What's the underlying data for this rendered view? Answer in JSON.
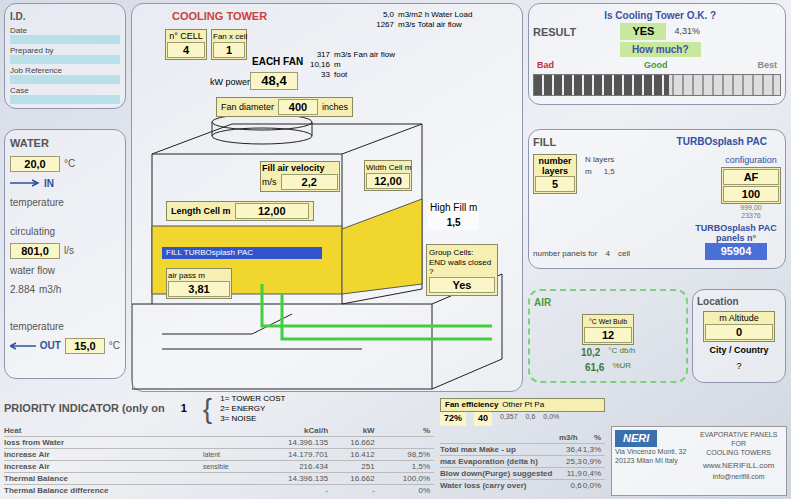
{
  "id_panel": {
    "title": "I.D.",
    "fields": [
      "Date",
      "Prepared by",
      "Job Reference",
      "Case"
    ]
  },
  "tower": {
    "title": "COOLING TOWER",
    "cells": {
      "label": "n° CELL",
      "value": "4"
    },
    "fans_per_cell": {
      "label": "Fan x cell",
      "value": "1"
    },
    "summary": [
      {
        "value": "5,0",
        "unit": "m3/m2 h Water Load"
      },
      {
        "value": "1267",
        "unit": "m3/s Total air flow"
      }
    ],
    "fan_summary": [
      {
        "value": "317",
        "unit": "m3/s Fan air flow"
      },
      {
        "value": "10,16",
        "unit": "m"
      },
      {
        "value": "33",
        "unit": "foot"
      }
    ],
    "each_fan": "EACH FAN",
    "kw_label": "kW power",
    "kw_value": "48,4",
    "fan_diameter": {
      "label": "Fan diameter",
      "value": "400",
      "unit": "inches"
    },
    "fill_air_velocity": {
      "label": "Fill air velocity",
      "unit": "m/s",
      "value": "2,2"
    },
    "width_cell": {
      "label": "Width Cell m",
      "value": "12,00"
    },
    "length_cell": {
      "label": "Length Cell m",
      "value": "12,00"
    },
    "high_fill": {
      "label": "High Fill m",
      "value": "1,5"
    },
    "fill_name": "FILL TURBOsplash PAC",
    "air_pass": {
      "label": "air pass m",
      "value": "3,81"
    },
    "group_cells": {
      "label": "Group Cells:",
      "question": "END walls closed ?",
      "value": "Yes"
    }
  },
  "water": {
    "title": "WATER",
    "in_temp": "20,0",
    "in_unit": "°C",
    "in_arrow": "IN",
    "in_label": "temperature",
    "flow_label": "circulating",
    "flow": "801,0",
    "flow_unit": "l/s",
    "flow_label2": "water flow",
    "flow_m3": "2.884",
    "flow_m3_unit": "m3/h",
    "out_label": "temperature",
    "out_arrow": "OUT",
    "out_temp": "15,0",
    "out_unit": "°C"
  },
  "result": {
    "title": "RESULT",
    "question": "Is Cooling Tower O.K. ?",
    "answer": "YES",
    "margin": "4,31%",
    "how_much": "How much?",
    "scale": [
      "Bad",
      "Good",
      "Best"
    ],
    "level": 0.55
  },
  "fill": {
    "title": "FILL",
    "layers_label": "number layers",
    "layers": "5",
    "layers_unit": "N layers",
    "height_unit": "m",
    "height": "1,5",
    "brand": "TURBOsplash PAC",
    "config_label": "configuration",
    "config": "AF",
    "config_value": "100",
    "extra": [
      "999,00",
      "23376"
    ],
    "panels_label": "TURBOsplash PAC panels n°",
    "panels": "95904",
    "panels_for": "number panels for",
    "panels_cells": "4",
    "panels_cell_unit": "cell"
  },
  "air": {
    "title": "AIR",
    "wet_bulb_label": "°C Wet Bulb",
    "wet_bulb": "12",
    "readings": [
      {
        "value": "10,2",
        "unit": "°C db/h"
      },
      {
        "value": "61,6",
        "unit": "%UR"
      }
    ]
  },
  "location": {
    "title": "Location",
    "altitude_label": "m Altitude",
    "altitude": "0",
    "city_label": "City / Country",
    "city": "?"
  },
  "fan_efficiency": {
    "label": "Fan efficiency",
    "value": "72%",
    "other_label": "Other Pt Pa",
    "other": "40",
    "notes": [
      "0,357",
      "0,6",
      "0,0%"
    ]
  },
  "priority": {
    "label": "PRIORITY INDICATOR (only on",
    "value": "1",
    "options": [
      "1= TOWER COST",
      "2= ENERGY",
      "3= NOISE"
    ]
  },
  "heat_table": {
    "columns": [
      "Heat",
      "kCal/h",
      "kW",
      "%"
    ],
    "rows": [
      {
        "label": "loss from Water",
        "sub": "",
        "kcal": "14.396.135",
        "kw": "16.662",
        "pct": ""
      },
      {
        "label": "increase Air",
        "sub": "latent",
        "kcal": "14.179.701",
        "kw": "16.412",
        "pct": "98,5%"
      },
      {
        "label": "increase Air",
        "sub": "sensible",
        "kcal": "216.434",
        "kw": "251",
        "pct": "1,5%"
      },
      {
        "label": "Thermal Balance",
        "sub": "",
        "kcal": "14.396.135",
        "kw": "16.662",
        "pct": "100,0%"
      },
      {
        "label": "Thermal Balance difference",
        "sub": "",
        "kcal": "-",
        "kw": "-",
        "pct": "0%"
      }
    ]
  },
  "water_table": {
    "columns": [
      "",
      "m3/h",
      "%"
    ],
    "rows": [
      {
        "label": "Total max Make - up",
        "value": "36,4",
        "pct": "1,3%"
      },
      {
        "label": "max Evaporation (delta h)",
        "value": "25,3",
        "pct": "0,9%"
      },
      {
        "label": "Blow down(Purge) suggested",
        "value": "11,9",
        "pct": "0,4%"
      },
      {
        "label": "Water loss (carry over)",
        "value": "0,6",
        "pct": "0,0%"
      }
    ]
  },
  "company": {
    "logo": "NERI",
    "address": [
      "Via Vincenzo Monti, 32",
      "20123 Milan MI Italy"
    ],
    "tagline": [
      "EVAPORATIVE PANELS",
      "FOR",
      "COOLING TOWERS"
    ],
    "web": "www.NERIFILL.com",
    "email": "info@nerifill.com"
  }
}
